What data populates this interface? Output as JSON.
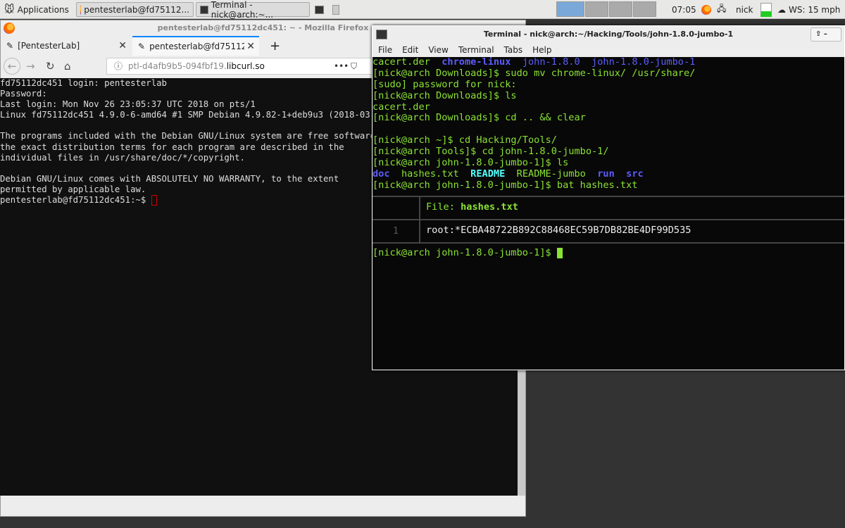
{
  "panel": {
    "apps": "Applications",
    "task1": "pentesterlab@fd75112...",
    "task2": "Terminal - nick@arch:~...",
    "clock": "07:05",
    "user": "nick",
    "weather": "WS: 15 mph"
  },
  "firefox": {
    "title": "pentesterlab@fd75112dc451: ~ - Mozilla Firefox",
    "tabs": [
      {
        "label": "[PentesterLab]"
      },
      {
        "label": "pentesterlab@fd75112dc"
      }
    ],
    "url_prefix": "ptl-d4afb9b5-094fbf19.",
    "url_domain": "libcurl.so",
    "lines": [
      "fd75112dc451 login: pentesterlab",
      "Password:",
      "Last login: Mon Nov 26 23:05:37 UTC 2018 on pts/1",
      "Linux fd75112dc451 4.9.0-6-amd64 #1 SMP Debian 4.9.82-1+deb9u3 (2018-03",
      "",
      "The programs included with the Debian GNU/Linux system are free software",
      "the exact distribution terms for each program are described in the",
      "individual files in /usr/share/doc/*/copyright.",
      "",
      "Debian GNU/Linux comes with ABSOLUTELY NO WARRANTY, to the extent",
      "permitted by applicable law."
    ],
    "prompt": "pentesterlab@fd75112dc451:~$ "
  },
  "terminal": {
    "title": "Terminal - nick@arch:~/Hacking/Tools/john-1.8.0-jumbo-1",
    "menu": [
      "File",
      "Edit",
      "View",
      "Terminal",
      "Tabs",
      "Help"
    ],
    "ls1": [
      "cacert.der",
      "chrome-linux",
      "john-1.8.0",
      "john-1.8.0-jumbo-1"
    ],
    "lines": [
      "[nick@arch Downloads]$ sudo mv chrome-linux/ /usr/share/",
      "[sudo] password for nick:",
      "[nick@arch Downloads]$ ls",
      "cacert.der",
      "[nick@arch Downloads]$ cd .. && clear",
      "",
      "[nick@arch ~]$ cd Hacking/Tools/",
      "[nick@arch Tools]$ cd john-1.8.0-jumbo-1/",
      "[nick@arch john-1.8.0-jumbo-1]$ ls"
    ],
    "ls2": [
      "doc",
      "hashes.txt",
      "README",
      "README-jumbo",
      "run",
      "src"
    ],
    "bat_cmd": "[nick@arch john-1.8.0-jumbo-1]$ bat hashes.txt",
    "file_label": "File: ",
    "file_name": "hashes.txt",
    "line_no": "1",
    "hash": "root:*ECBA48722B892C88468EC59B7DB82BE4DF99D535",
    "prompt": "[nick@arch john-1.8.0-jumbo-1]$ "
  },
  "wallpaper": "trike"
}
